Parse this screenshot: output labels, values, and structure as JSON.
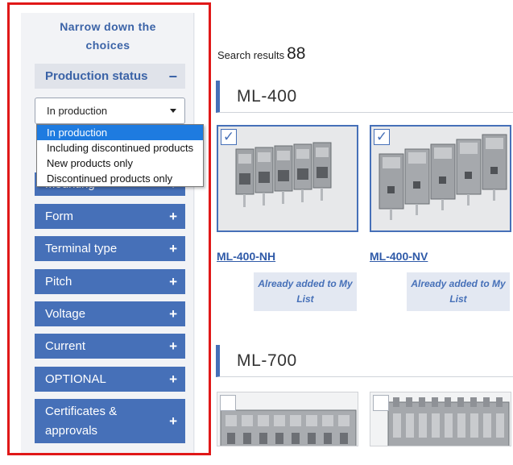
{
  "sidebar": {
    "title_line1": "Narrow down the",
    "title_line2": "choices",
    "production_status": {
      "label": "Production status",
      "collapse_symbol": "−",
      "selected_value": "In production",
      "options": [
        "In production",
        "Including discontinued products",
        "New products only",
        "Discontinued products only"
      ]
    },
    "filters": [
      {
        "label": "Mounting",
        "symbol": "+"
      },
      {
        "label": "Form",
        "symbol": "+"
      },
      {
        "label": "Terminal type",
        "symbol": "+"
      },
      {
        "label": "Pitch",
        "symbol": "+"
      },
      {
        "label": "Voltage",
        "symbol": "+"
      },
      {
        "label": "Current",
        "symbol": "+"
      },
      {
        "label": "OPTIONAL",
        "symbol": "+"
      },
      {
        "label": "Certificates &",
        "label2": "approvals",
        "symbol": "+"
      }
    ]
  },
  "results": {
    "label": "Search results",
    "count": "88"
  },
  "series": [
    {
      "title": "ML-400",
      "products": [
        {
          "name": "ML-400-NH",
          "checked": true,
          "mylist_line1": "Already added to My",
          "mylist_line2": "List"
        },
        {
          "name": "ML-400-NV",
          "checked": true,
          "mylist_line1": "Already added to My",
          "mylist_line2": "List"
        }
      ]
    },
    {
      "title": "ML-700",
      "products": [
        {
          "checked": false
        },
        {
          "checked": false
        }
      ]
    }
  ],
  "colors": {
    "accent": "#4670b8",
    "highlight": "#e01818",
    "dropdown_selected": "#1e7be0"
  }
}
